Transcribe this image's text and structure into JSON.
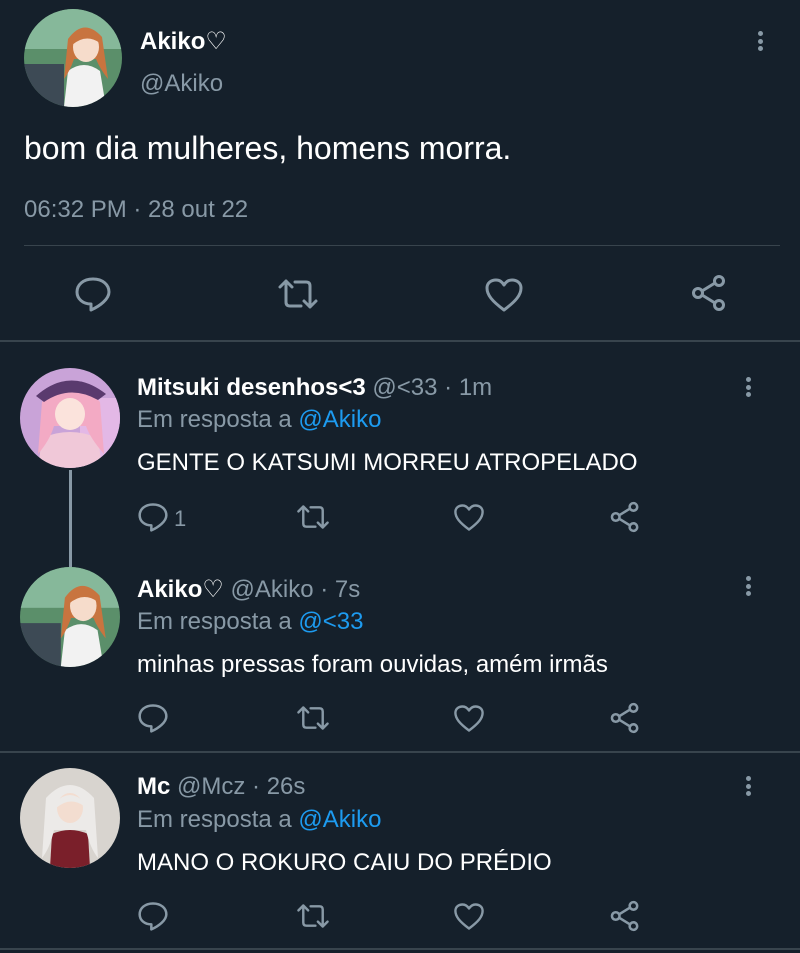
{
  "main_tweet": {
    "display_name": "Akiko♡",
    "handle": "@Akiko",
    "text": "bom dia mulheres, homens morra.",
    "timestamp": "06:32 PM · 28 out 22"
  },
  "replies": [
    {
      "display_name": "Mitsuki desenhos<3",
      "meta": "@<33 · 1m",
      "reply_prefix": "Em resposta a",
      "reply_to": "@Akiko",
      "text": "GENTE O KATSUMI MORREU ATROPELADO",
      "reply_count": "1"
    },
    {
      "display_name": "Akiko♡",
      "meta": "@Akiko · 7s",
      "reply_prefix": "Em resposta a",
      "reply_to": "@<33",
      "text": "minhas pressas foram ouvidas, amém irmãs",
      "reply_count": ""
    },
    {
      "display_name": "Mc",
      "meta": "@Mcz · 26s",
      "reply_prefix": "Em resposta a",
      "reply_to": "@Akiko",
      "text": "MANO O ROKURO CAIU DO PRÉDIO",
      "reply_count": ""
    }
  ],
  "icons": [
    "reply-icon",
    "retweet-icon",
    "like-icon",
    "share-icon",
    "more-icon"
  ],
  "colors": {
    "background": "#15202b",
    "text": "#ffffff",
    "secondary": "#8899a6",
    "link": "#1d9bf0",
    "divider": "#38444d"
  }
}
